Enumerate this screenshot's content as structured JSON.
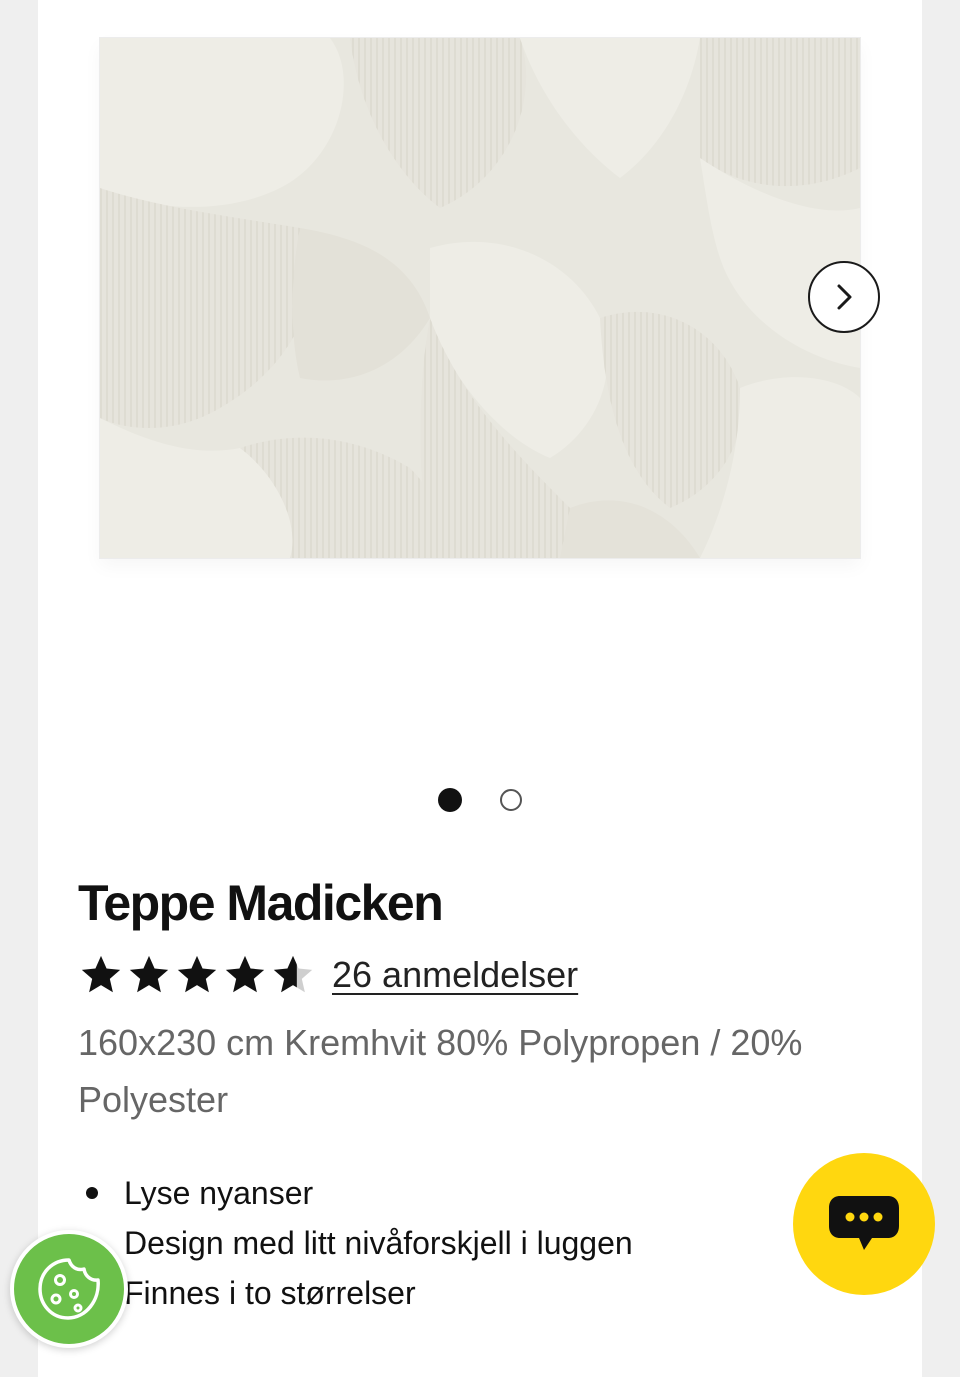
{
  "product": {
    "title": "Teppe Madicken",
    "rating": 4.5,
    "reviews_label": "26 anmeldelser",
    "description": "160x230 cm Kremhvit 80% Polypropen / 20% Polyester",
    "features": [
      "Lyse nyanser",
      "Design med litt nivåforskjell i luggen",
      "Finnes i to størrelser"
    ]
  },
  "gallery": {
    "image_name": "rug-image",
    "current_slide": 1,
    "total_slides": 2,
    "next_icon": "chevron-right-icon"
  },
  "widgets": {
    "chat_icon": "chat-bubble-icon",
    "cookie_icon": "cookie-icon"
  },
  "colors": {
    "chat_button": "#ffd70f",
    "cookie_button": "#6cc04a",
    "rug": "#e9e8e1"
  }
}
